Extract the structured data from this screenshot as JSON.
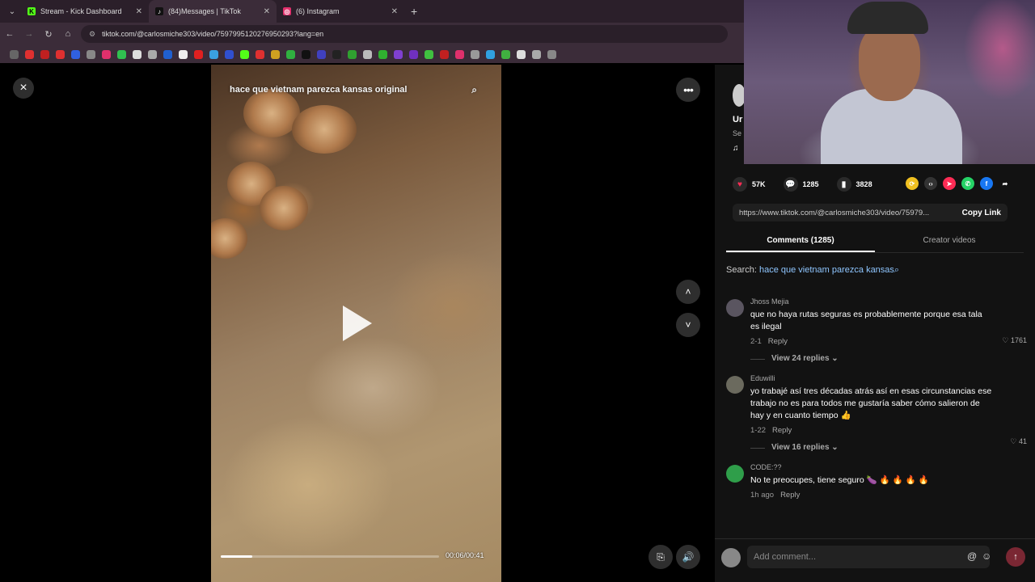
{
  "browser": {
    "tabs": [
      {
        "title": "Stream - Kick Dashboard",
        "favicon": "kick-icon",
        "color": "#53fc18",
        "glyph": "K",
        "active": false
      },
      {
        "title": "(84)Messages | TikTok",
        "favicon": "tiktok-icon",
        "color": "#111111",
        "glyph": "♪",
        "active": true
      },
      {
        "title": "(6) Instagram",
        "favicon": "instagram-icon",
        "color": "#e1306c",
        "glyph": "◎",
        "active": false
      }
    ],
    "new_tab": "+",
    "url": "tiktok.com/@carlosmiche303/video/7597995120276950293?lang=en"
  },
  "video": {
    "search_text": "hace que vietnam parezca kansas original",
    "time": "00:06/00:41",
    "progress": 0.146
  },
  "icons": {
    "close": "×",
    "more": "•••",
    "up": "˄",
    "down": "˅",
    "captions": "⎘",
    "volume": "🔊"
  },
  "panel": {
    "author_name": "Ur",
    "author_sub": "Se",
    "music_icon": "♫",
    "stats": {
      "likes": "57K",
      "comments": "1285",
      "saves": "3828"
    },
    "link": "https://www.tiktok.com/@carlosmiche303/video/75979...",
    "copy_label": "Copy Link",
    "tabs": [
      "Comments (1285)",
      "Creator videos"
    ],
    "search_prefix": "Search:",
    "search_term": "hace que vietnam parezca kansas",
    "comments": [
      {
        "name": "Jhoss Mejia",
        "text": "que no haya rutas seguras es probablemente porque esa tala es ilegal",
        "date": "2-1",
        "reply": "Reply",
        "likes": "1761",
        "view_replies": "View 24 replies ⌄",
        "avatar_color": "#5a5560"
      },
      {
        "name": "Eduwilli",
        "text": "yo trabajé así tres décadas atrás así en esas circunstancias ese trabajo no es para todos me gustaría saber cómo salieron de hay y en cuanto tiempo 👍",
        "date": "1-22",
        "reply": "Reply",
        "likes": "41",
        "view_replies": "View 16 replies ⌄",
        "avatar_color": "#6b6a5e"
      },
      {
        "name": "CODE:??",
        "text": "No te preocupes, tiene seguro 🍆 🔥 🔥 🔥 🔥",
        "date": "1h ago",
        "reply": "Reply",
        "likes": "",
        "view_replies": "",
        "avatar_color": "#2f9e4a"
      }
    ],
    "add_comment_placeholder": "Add comment...",
    "at_icon": "@",
    "emoji_icon": "☺",
    "send_icon": "↑"
  }
}
